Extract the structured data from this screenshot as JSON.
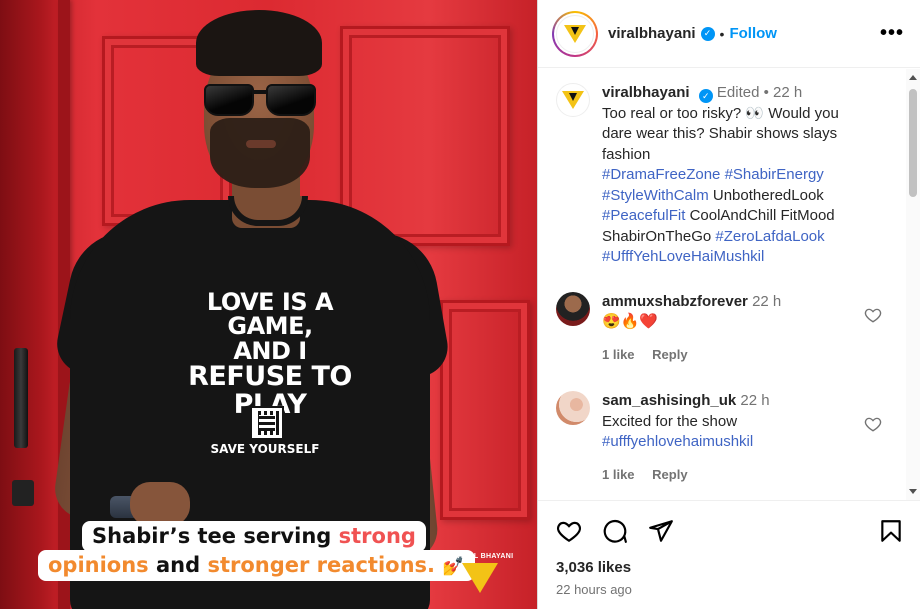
{
  "header": {
    "username": "viralbhayani",
    "separator": "•",
    "follow_label": "Follow",
    "more_label": "•••"
  },
  "image": {
    "tee_line1": "LOVE IS A GAME,",
    "tee_line2": "AND I",
    "tee_line3": "REFUSE TO PLAY",
    "tee_small": "SAVE YOURSELF",
    "caption_part1": "Shabir’s tee serving ",
    "caption_accent1": "strong",
    "caption_accent2": "opinions",
    "caption_part2": " and ",
    "caption_accent3": "stronger reactions.",
    "caption_emoji": "💅",
    "watermark": "VIRAL BHAYANI"
  },
  "caption": {
    "username": "viralbhayani",
    "edited": "Edited",
    "separator": "•",
    "time": "22 h",
    "text": "Too real or too risky? 👀 Would you dare wear this? Shabir shows slays fashion",
    "tag1": "#DramaFreeZone",
    "tag2": "#ShabirEnergy",
    "tag3": "#StyleWithCalm",
    "plain1": "UnbotheredLook",
    "tag4": "#PeacefulFit",
    "plain2": "CoolAndChill FitMood",
    "plain3": "ShabirOnTheGo",
    "tag5": "#ZeroLafdaLook",
    "tag6": "#UfffYehLoveHaiMushkil"
  },
  "comments": [
    {
      "username": "ammuxshabzforever",
      "time": "22 h",
      "text": "😍🔥❤️",
      "likes": "1 like",
      "reply": "Reply"
    },
    {
      "username": "sam_ashisingh_uk",
      "time": "22 h",
      "text": "Excited for the show",
      "tag": "#ufffyehlovehaimushkil",
      "likes": "1 like",
      "reply": "Reply"
    }
  ],
  "footer": {
    "likes": "3,036 likes",
    "time": "22 hours ago"
  },
  "colors": {
    "accent_blue": "#0095f6",
    "hashtag": "#3f64c4",
    "caption_red": "#f05252",
    "caption_orange": "#f28a2e",
    "door_red": "#dc2a31",
    "logo_yellow": "#f3c316"
  }
}
